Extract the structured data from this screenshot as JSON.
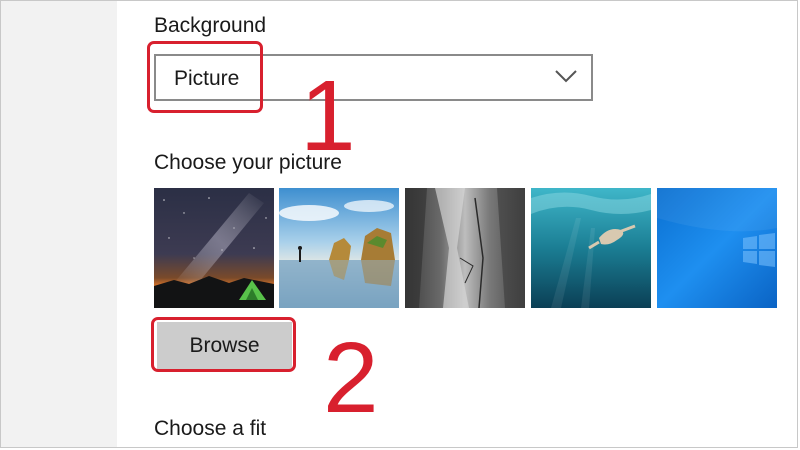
{
  "settings": {
    "background_label": "Background",
    "background_dropdown": {
      "selected": "Picture",
      "icon": "chevron-down-icon"
    },
    "choose_picture_label": "Choose your picture",
    "pictures": [
      {
        "name": "night-sky-tent"
      },
      {
        "name": "beach-rocks-runner"
      },
      {
        "name": "rock-cliff-waterfall"
      },
      {
        "name": "underwater-swimmer"
      },
      {
        "name": "windows-blue-logo"
      }
    ],
    "browse_label": "Browse",
    "choose_fit_label": "Choose a fit"
  },
  "annotations": {
    "step_1": "1",
    "step_2": "2",
    "highlight_color": "#d8202e"
  },
  "colors": {
    "sidebar": "#f2f2f2",
    "button": "#cccccc",
    "dropdown_border": "#8a8a8a"
  }
}
